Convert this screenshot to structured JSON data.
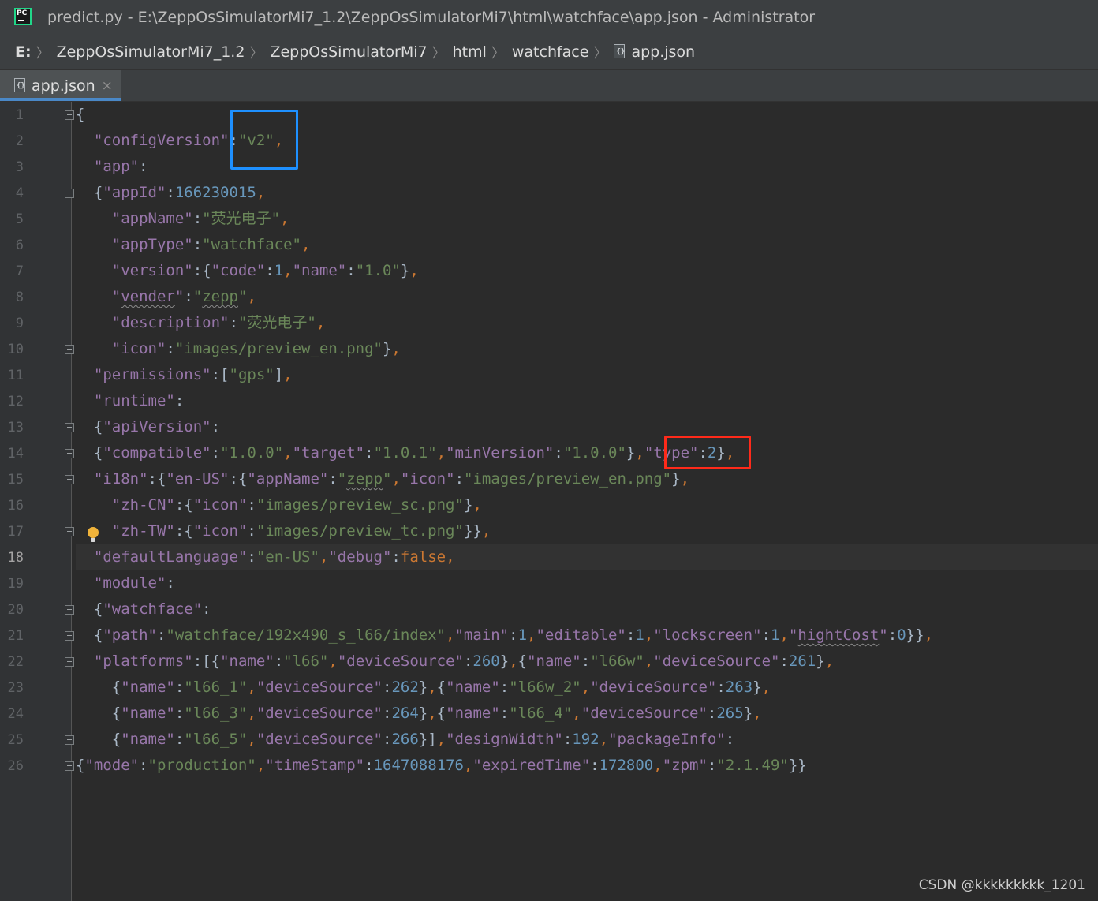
{
  "window": {
    "title": "predict.py - E:\\ZeppOsSimulatorMi7_1.2\\ZeppOsSimulatorMi7\\html\\watchface\\app.json - Administrator",
    "logo_text": "PC"
  },
  "breadcrumb": [
    "E:",
    "ZeppOsSimulatorMi7_1.2",
    "ZeppOsSimulatorMi7",
    "html",
    "watchface",
    "app.json"
  ],
  "tab": {
    "label": "app.json",
    "close": "×"
  },
  "editor": {
    "active_line": 18,
    "line_numbers": [
      "1",
      "2",
      "3",
      "4",
      "5",
      "6",
      "7",
      "8",
      "9",
      "10",
      "11",
      "12",
      "13",
      "14",
      "15",
      "16",
      "17",
      "18",
      "19",
      "20",
      "21",
      "22",
      "23",
      "24",
      "25",
      "26"
    ],
    "lines": [
      [
        [
          "b",
          "{"
        ]
      ],
      [
        [
          "b",
          "  "
        ],
        [
          "k",
          "\"configVersion\""
        ],
        [
          "b",
          ":"
        ],
        [
          "s",
          "\"v2\""
        ],
        [
          "p",
          ","
        ]
      ],
      [
        [
          "b",
          "  "
        ],
        [
          "k",
          "\"app\""
        ],
        [
          "b",
          ":"
        ]
      ],
      [
        [
          "b",
          "  {"
        ],
        [
          "k",
          "\"appId\""
        ],
        [
          "b",
          ":"
        ],
        [
          "n",
          "166230015"
        ],
        [
          "p",
          ","
        ]
      ],
      [
        [
          "b",
          "    "
        ],
        [
          "k",
          "\"appName\""
        ],
        [
          "b",
          ":"
        ],
        [
          "s",
          "\"荧光电子\""
        ],
        [
          "p",
          ","
        ]
      ],
      [
        [
          "b",
          "    "
        ],
        [
          "k",
          "\"appType\""
        ],
        [
          "b",
          ":"
        ],
        [
          "s",
          "\"watchface\""
        ],
        [
          "p",
          ","
        ]
      ],
      [
        [
          "b",
          "    "
        ],
        [
          "k",
          "\"version\""
        ],
        [
          "b",
          ":{"
        ],
        [
          "k",
          "\"code\""
        ],
        [
          "b",
          ":"
        ],
        [
          "n",
          "1"
        ],
        [
          "p",
          ","
        ],
        [
          "k",
          "\"name\""
        ],
        [
          "b",
          ":"
        ],
        [
          "s",
          "\"1.0\""
        ],
        [
          "b",
          "}"
        ],
        [
          "p",
          ","
        ]
      ],
      [
        [
          "b",
          "    "
        ],
        [
          "k",
          "\""
        ],
        [
          "ksq",
          "vender"
        ],
        [
          "k",
          "\""
        ],
        [
          "b",
          ":"
        ],
        [
          "s",
          "\""
        ],
        [
          "ssq",
          "zepp"
        ],
        [
          "s",
          "\""
        ],
        [
          "p",
          ","
        ]
      ],
      [
        [
          "b",
          "    "
        ],
        [
          "k",
          "\"description\""
        ],
        [
          "b",
          ":"
        ],
        [
          "s",
          "\"荧光电子\""
        ],
        [
          "p",
          ","
        ]
      ],
      [
        [
          "b",
          "    "
        ],
        [
          "k",
          "\"icon\""
        ],
        [
          "b",
          ":"
        ],
        [
          "s",
          "\"images/preview_en.png\""
        ],
        [
          "b",
          "}"
        ],
        [
          "p",
          ","
        ]
      ],
      [
        [
          "b",
          "  "
        ],
        [
          "k",
          "\"permissions\""
        ],
        [
          "b",
          ":["
        ],
        [
          "s",
          "\"gps\""
        ],
        [
          "b",
          "]"
        ],
        [
          "p",
          ","
        ]
      ],
      [
        [
          "b",
          "  "
        ],
        [
          "k",
          "\"runtime\""
        ],
        [
          "b",
          ":"
        ]
      ],
      [
        [
          "b",
          "  {"
        ],
        [
          "k",
          "\"apiVersion\""
        ],
        [
          "b",
          ":"
        ]
      ],
      [
        [
          "b",
          "  {"
        ],
        [
          "k",
          "\"compatible\""
        ],
        [
          "b",
          ":"
        ],
        [
          "s",
          "\"1.0.0\""
        ],
        [
          "p",
          ","
        ],
        [
          "k",
          "\"target\""
        ],
        [
          "b",
          ":"
        ],
        [
          "s",
          "\"1.0.1\""
        ],
        [
          "p",
          ","
        ],
        [
          "k",
          "\"minVersion\""
        ],
        [
          "b",
          ":"
        ],
        [
          "s",
          "\"1.0.0\""
        ],
        [
          "b",
          "}"
        ],
        [
          "p",
          ","
        ],
        [
          "k",
          "\"type\""
        ],
        [
          "b",
          ":"
        ],
        [
          "n",
          "2"
        ],
        [
          "b",
          "}"
        ],
        [
          "p",
          ","
        ]
      ],
      [
        [
          "b",
          "  "
        ],
        [
          "k",
          "\"i18n\""
        ],
        [
          "b",
          ":{"
        ],
        [
          "k",
          "\"en-US\""
        ],
        [
          "b",
          ":{"
        ],
        [
          "k",
          "\"appName\""
        ],
        [
          "b",
          ":"
        ],
        [
          "s",
          "\""
        ],
        [
          "ssq",
          "zepp"
        ],
        [
          "s",
          "\""
        ],
        [
          "p",
          ","
        ],
        [
          "k",
          "\"icon\""
        ],
        [
          "b",
          ":"
        ],
        [
          "s",
          "\"images/preview_en.png\""
        ],
        [
          "b",
          "}"
        ],
        [
          "p",
          ","
        ]
      ],
      [
        [
          "b",
          "    "
        ],
        [
          "k",
          "\"zh-CN\""
        ],
        [
          "b",
          ":{"
        ],
        [
          "k",
          "\"icon\""
        ],
        [
          "b",
          ":"
        ],
        [
          "s",
          "\"images/preview_sc.png\""
        ],
        [
          "b",
          "}"
        ],
        [
          "p",
          ","
        ]
      ],
      [
        [
          "b",
          "    "
        ],
        [
          "k",
          "\"zh-TW\""
        ],
        [
          "b",
          ":{"
        ],
        [
          "k",
          "\"icon\""
        ],
        [
          "b",
          ":"
        ],
        [
          "s",
          "\"images/preview_tc.png\""
        ],
        [
          "b",
          "}}"
        ],
        [
          "p",
          ","
        ]
      ],
      [
        [
          "b",
          "  "
        ],
        [
          "k",
          "\"defaultLanguage\""
        ],
        [
          "b",
          ":"
        ],
        [
          "s",
          "\"en-US\""
        ],
        [
          "p",
          ","
        ],
        [
          "k",
          "\"debug\""
        ],
        [
          "b",
          ":"
        ],
        [
          "kw",
          "false"
        ],
        [
          "p",
          ","
        ]
      ],
      [
        [
          "b",
          "  "
        ],
        [
          "k",
          "\"module\""
        ],
        [
          "b",
          ":"
        ]
      ],
      [
        [
          "b",
          "  {"
        ],
        [
          "k",
          "\"watchface\""
        ],
        [
          "b",
          ":"
        ]
      ],
      [
        [
          "b",
          "  {"
        ],
        [
          "k",
          "\"path\""
        ],
        [
          "b",
          ":"
        ],
        [
          "s",
          "\"watchface/192x490_s_l66/index\""
        ],
        [
          "p",
          ","
        ],
        [
          "k",
          "\"main\""
        ],
        [
          "b",
          ":"
        ],
        [
          "n",
          "1"
        ],
        [
          "p",
          ","
        ],
        [
          "k",
          "\"editable\""
        ],
        [
          "b",
          ":"
        ],
        [
          "n",
          "1"
        ],
        [
          "p",
          ","
        ],
        [
          "k",
          "\"lockscreen\""
        ],
        [
          "b",
          ":"
        ],
        [
          "n",
          "1"
        ],
        [
          "p",
          ","
        ],
        [
          "k",
          "\""
        ],
        [
          "ksq",
          "hightCost"
        ],
        [
          "k",
          "\""
        ],
        [
          "b",
          ":"
        ],
        [
          "n",
          "0"
        ],
        [
          "b",
          "}}"
        ],
        [
          "p",
          ","
        ]
      ],
      [
        [
          "b",
          "  "
        ],
        [
          "k",
          "\"platforms\""
        ],
        [
          "b",
          ":[{"
        ],
        [
          "k",
          "\"name\""
        ],
        [
          "b",
          ":"
        ],
        [
          "s",
          "\"l66\""
        ],
        [
          "p",
          ","
        ],
        [
          "k",
          "\"deviceSource\""
        ],
        [
          "b",
          ":"
        ],
        [
          "n",
          "260"
        ],
        [
          "b",
          "}"
        ],
        [
          "p",
          ","
        ],
        [
          "b",
          "{"
        ],
        [
          "k",
          "\"name\""
        ],
        [
          "b",
          ":"
        ],
        [
          "s",
          "\"l66w\""
        ],
        [
          "p",
          ","
        ],
        [
          "k",
          "\"deviceSource\""
        ],
        [
          "b",
          ":"
        ],
        [
          "n",
          "261"
        ],
        [
          "b",
          "}"
        ],
        [
          "p",
          ","
        ]
      ],
      [
        [
          "b",
          "    {"
        ],
        [
          "k",
          "\"name\""
        ],
        [
          "b",
          ":"
        ],
        [
          "s",
          "\"l66_1\""
        ],
        [
          "p",
          ","
        ],
        [
          "k",
          "\"deviceSource\""
        ],
        [
          "b",
          ":"
        ],
        [
          "n",
          "262"
        ],
        [
          "b",
          "}"
        ],
        [
          "p",
          ","
        ],
        [
          "b",
          "{"
        ],
        [
          "k",
          "\"name\""
        ],
        [
          "b",
          ":"
        ],
        [
          "s",
          "\"l66w_2\""
        ],
        [
          "p",
          ","
        ],
        [
          "k",
          "\"deviceSource\""
        ],
        [
          "b",
          ":"
        ],
        [
          "n",
          "263"
        ],
        [
          "b",
          "}"
        ],
        [
          "p",
          ","
        ]
      ],
      [
        [
          "b",
          "    {"
        ],
        [
          "k",
          "\"name\""
        ],
        [
          "b",
          ":"
        ],
        [
          "s",
          "\"l66_3\""
        ],
        [
          "p",
          ","
        ],
        [
          "k",
          "\"deviceSource\""
        ],
        [
          "b",
          ":"
        ],
        [
          "n",
          "264"
        ],
        [
          "b",
          "}"
        ],
        [
          "p",
          ","
        ],
        [
          "b",
          "{"
        ],
        [
          "k",
          "\"name\""
        ],
        [
          "b",
          ":"
        ],
        [
          "s",
          "\"l66_4\""
        ],
        [
          "p",
          ","
        ],
        [
          "k",
          "\"deviceSource\""
        ],
        [
          "b",
          ":"
        ],
        [
          "n",
          "265"
        ],
        [
          "b",
          "}"
        ],
        [
          "p",
          ","
        ]
      ],
      [
        [
          "b",
          "    {"
        ],
        [
          "k",
          "\"name\""
        ],
        [
          "b",
          ":"
        ],
        [
          "s",
          "\"l66_5\""
        ],
        [
          "p",
          ","
        ],
        [
          "k",
          "\"deviceSource\""
        ],
        [
          "b",
          ":"
        ],
        [
          "n",
          "266"
        ],
        [
          "b",
          "}]"
        ],
        [
          "p",
          ","
        ],
        [
          "k",
          "\"designWidth\""
        ],
        [
          "b",
          ":"
        ],
        [
          "n",
          "192"
        ],
        [
          "p",
          ","
        ],
        [
          "k",
          "\"packageInfo\""
        ],
        [
          "b",
          ":"
        ]
      ],
      [
        [
          "b",
          "{"
        ],
        [
          "k",
          "\"mode\""
        ],
        [
          "b",
          ":"
        ],
        [
          "s",
          "\"production\""
        ],
        [
          "p",
          ","
        ],
        [
          "k",
          "\"timeStamp\""
        ],
        [
          "b",
          ":"
        ],
        [
          "n",
          "1647088176"
        ],
        [
          "p",
          ","
        ],
        [
          "k",
          "\"expiredTime\""
        ],
        [
          "b",
          ":"
        ],
        [
          "n",
          "172800"
        ],
        [
          "p",
          ","
        ],
        [
          "k",
          "\"zpm\""
        ],
        [
          "b",
          ":"
        ],
        [
          "s",
          "\"2.1.49\""
        ],
        [
          "b",
          "}}"
        ]
      ]
    ],
    "fold_markers": [
      1,
      4,
      10,
      13,
      14,
      15,
      17,
      20,
      21,
      22,
      25,
      26
    ]
  },
  "watermark": "CSDN @kkkkkkkkk_1201",
  "colors": {
    "background": "#2b2b2b",
    "key": "#9876aa",
    "string": "#6a8759",
    "number": "#6897bb",
    "punctuation": "#cc7832",
    "highlight_blue": "#1e90ff",
    "highlight_red": "#ff2a1a"
  }
}
